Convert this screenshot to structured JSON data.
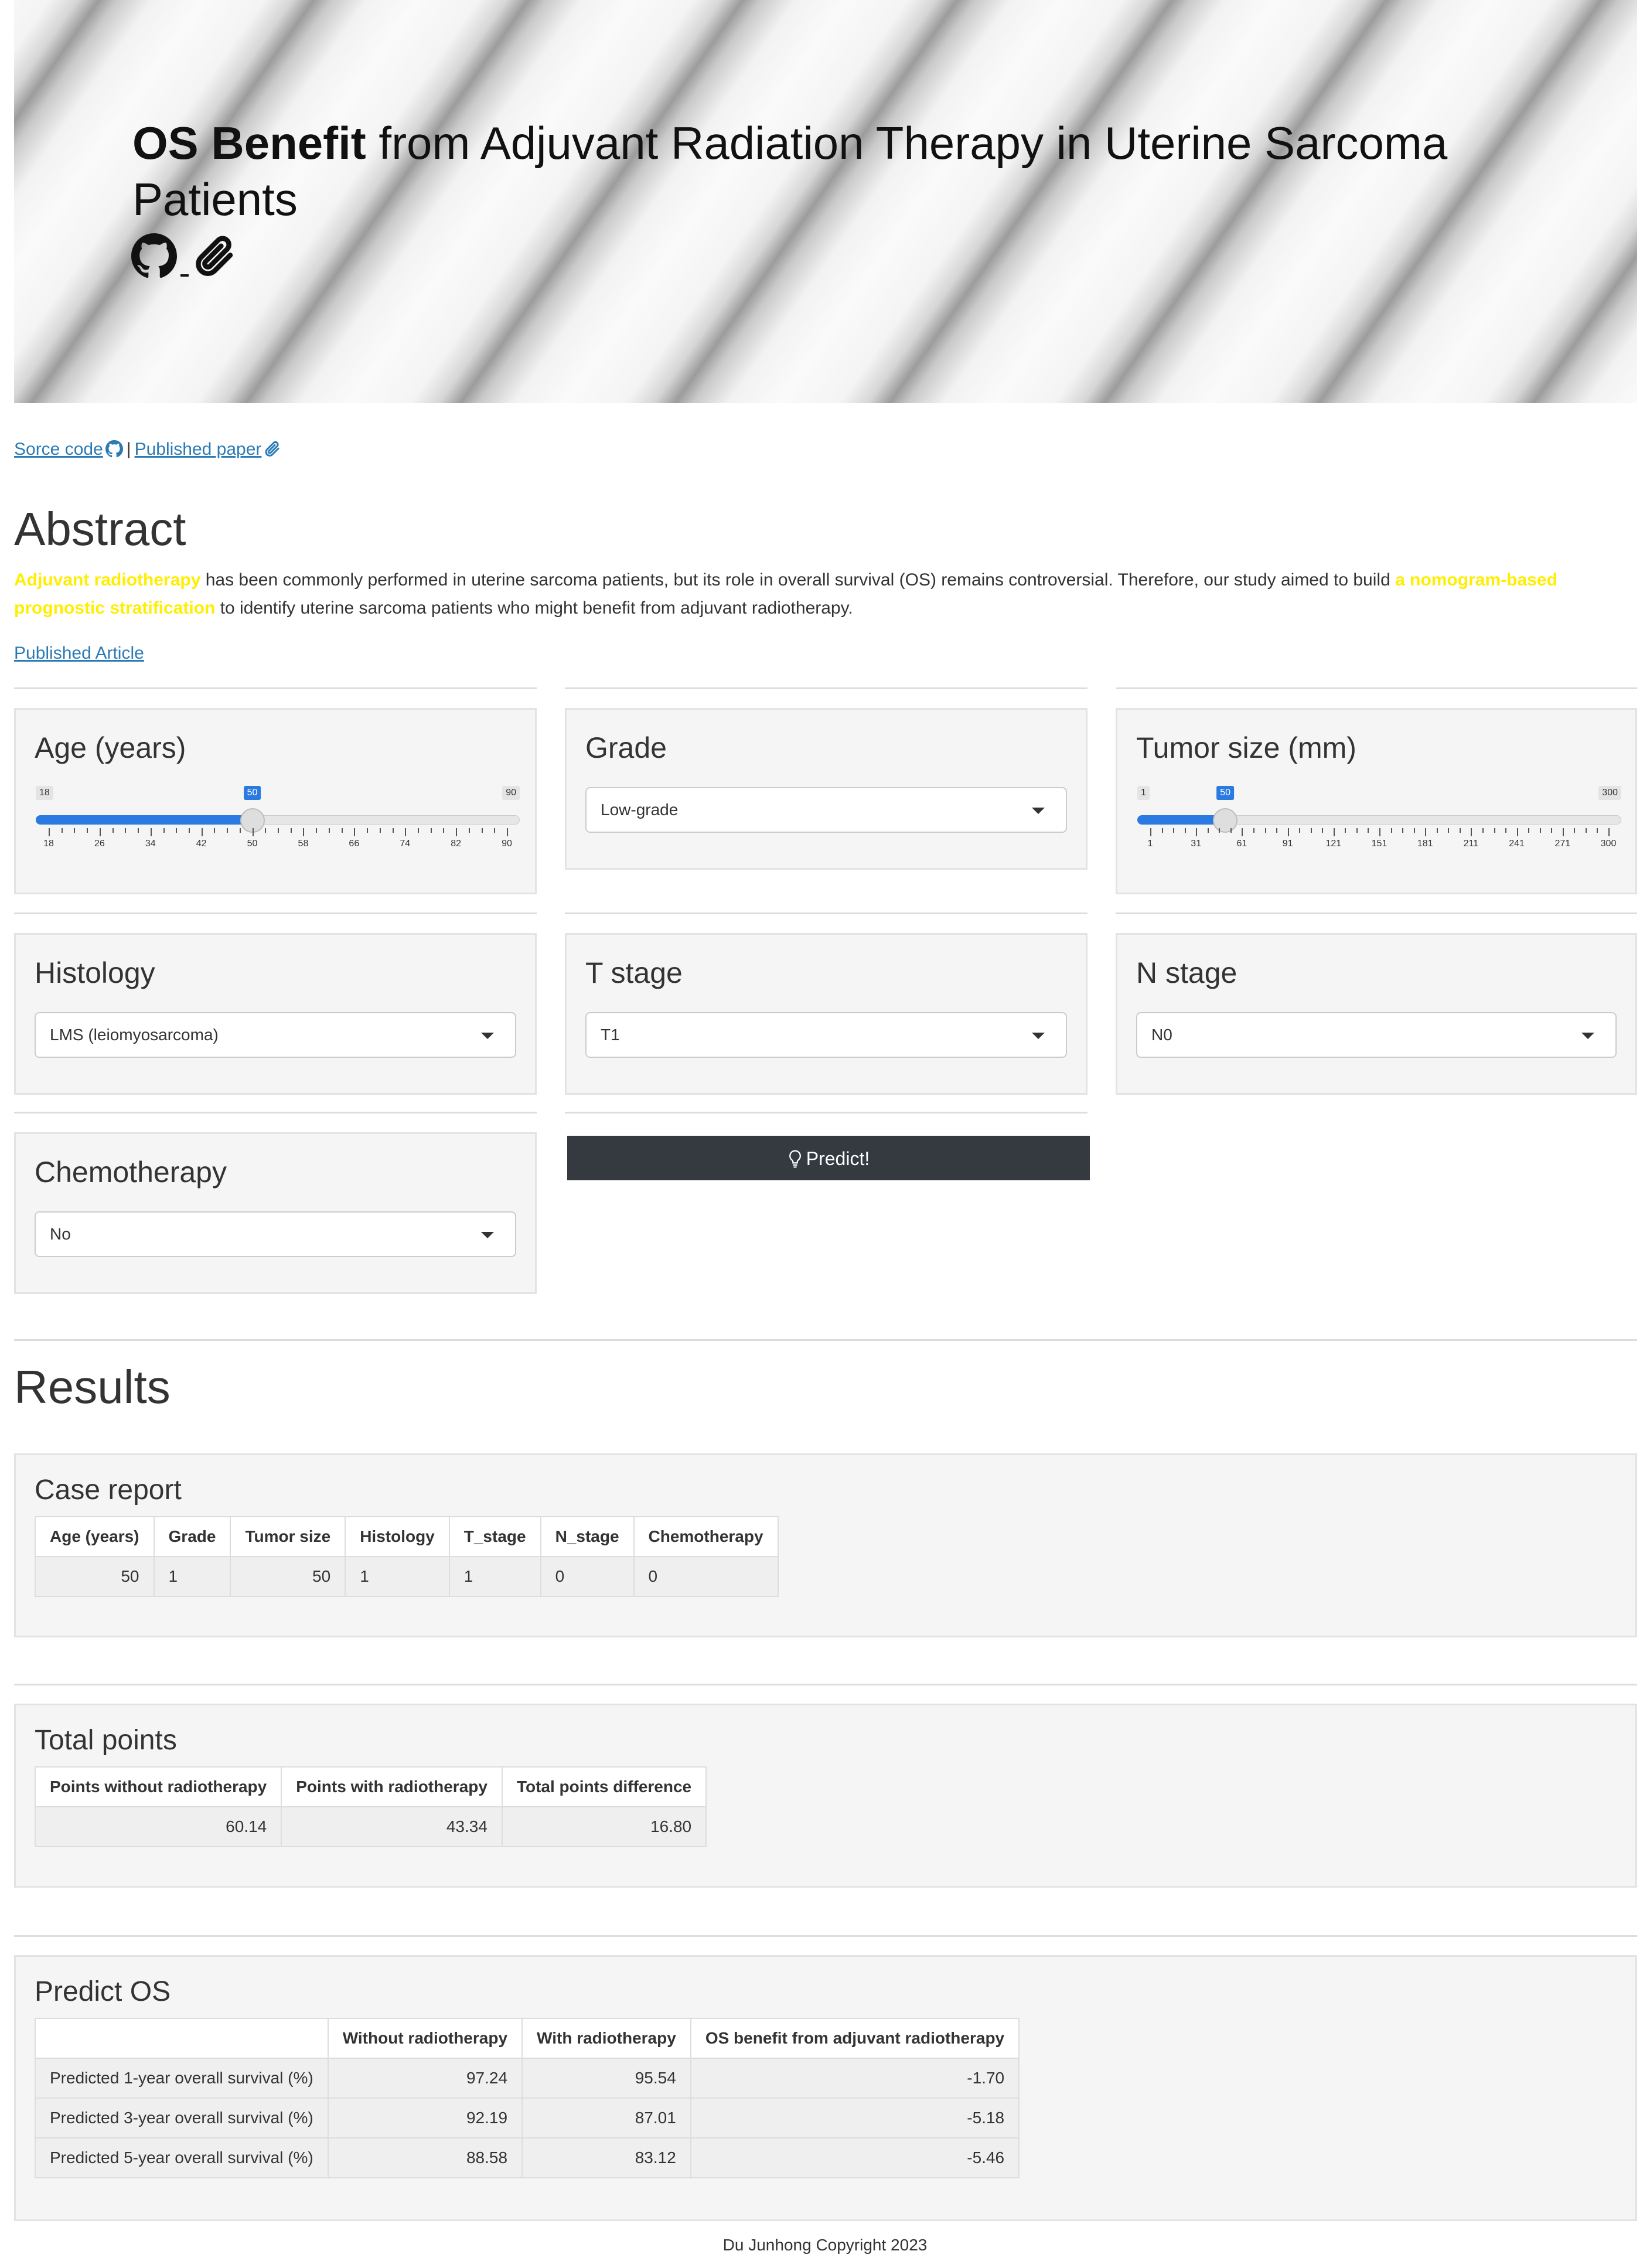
{
  "header": {
    "title_bold": "OS Benefit",
    "title_rest": " from Adjuvant Radiation Therapy in Uterine Sarcoma Patients",
    "icons": [
      "github-icon",
      "paperclip-icon"
    ]
  },
  "links": {
    "source_code": "Sorce code",
    "separator": "|",
    "published_paper": "Published paper"
  },
  "abstract": {
    "heading": "Abstract",
    "highlight_1": "Adjuvant radiotherapy",
    "text_1": " has been commonly performed in uterine sarcoma patients, but its role in overall survival (OS) remains controversial. Therefore, our study aimed to build ",
    "highlight_2": "a nomogram-based prognostic stratification",
    "text_2": " to identify uterine sarcoma patients who might benefit from adjuvant radiotherapy.",
    "link": "Published Article"
  },
  "inputs": {
    "age": {
      "label": "Age (years)",
      "min": 18,
      "max": 90,
      "value": 50,
      "min_label": "18",
      "max_label": "90",
      "value_label": "50",
      "ticks": [
        "18",
        "26",
        "34",
        "42",
        "50",
        "58",
        "66",
        "74",
        "82",
        "90"
      ]
    },
    "grade": {
      "label": "Grade",
      "selected": "Low-grade"
    },
    "tumor_size": {
      "label": "Tumor size (mm)",
      "min": 1,
      "max": 300,
      "value": 50,
      "min_label": "1",
      "max_label": "300",
      "value_label": "50",
      "ticks": [
        "1",
        "31",
        "61",
        "91",
        "121",
        "151",
        "181",
        "211",
        "241",
        "271",
        "300"
      ]
    },
    "histology": {
      "label": "Histology",
      "selected": "LMS (leiomyosarcoma)"
    },
    "t_stage": {
      "label": "T stage",
      "selected": "T1"
    },
    "n_stage": {
      "label": "N stage",
      "selected": "N0"
    },
    "chemotherapy": {
      "label": "Chemotherapy",
      "selected": "No"
    },
    "predict_button": "Predict!"
  },
  "results": {
    "heading": "Results",
    "case_report": {
      "title": "Case report",
      "headers": [
        "Age (years)",
        "Grade",
        "Tumor size",
        "Histology",
        "T_stage",
        "N_stage",
        "Chemotherapy"
      ],
      "row": [
        "50",
        "1",
        "50",
        "1",
        "1",
        "0",
        "0"
      ]
    },
    "total_points": {
      "title": "Total points",
      "headers": [
        "Points without radiotherapy",
        "Points with radiotherapy",
        "Total points difference"
      ],
      "row": [
        "60.14",
        "43.34",
        "16.80"
      ]
    },
    "predict_os": {
      "title": "Predict OS",
      "headers": [
        "",
        "Without radiotherapy",
        "With radiotherapy",
        "OS benefit from adjuvant radiotherapy"
      ],
      "rows": [
        [
          "Predicted 1-year overall survival (%)",
          "97.24",
          "95.54",
          "-1.70"
        ],
        [
          "Predicted 3-year overall survival (%)",
          "92.19",
          "87.01",
          "-5.18"
        ],
        [
          "Predicted 5-year overall survival (%)",
          "88.58",
          "83.12",
          "-5.46"
        ]
      ]
    }
  },
  "footer": "Du Junhong Copyright 2023",
  "colors": {
    "link": "#2a7ab5",
    "highlight": "#ffee00",
    "slider": "#2a7ae2",
    "button": "#343a40"
  }
}
